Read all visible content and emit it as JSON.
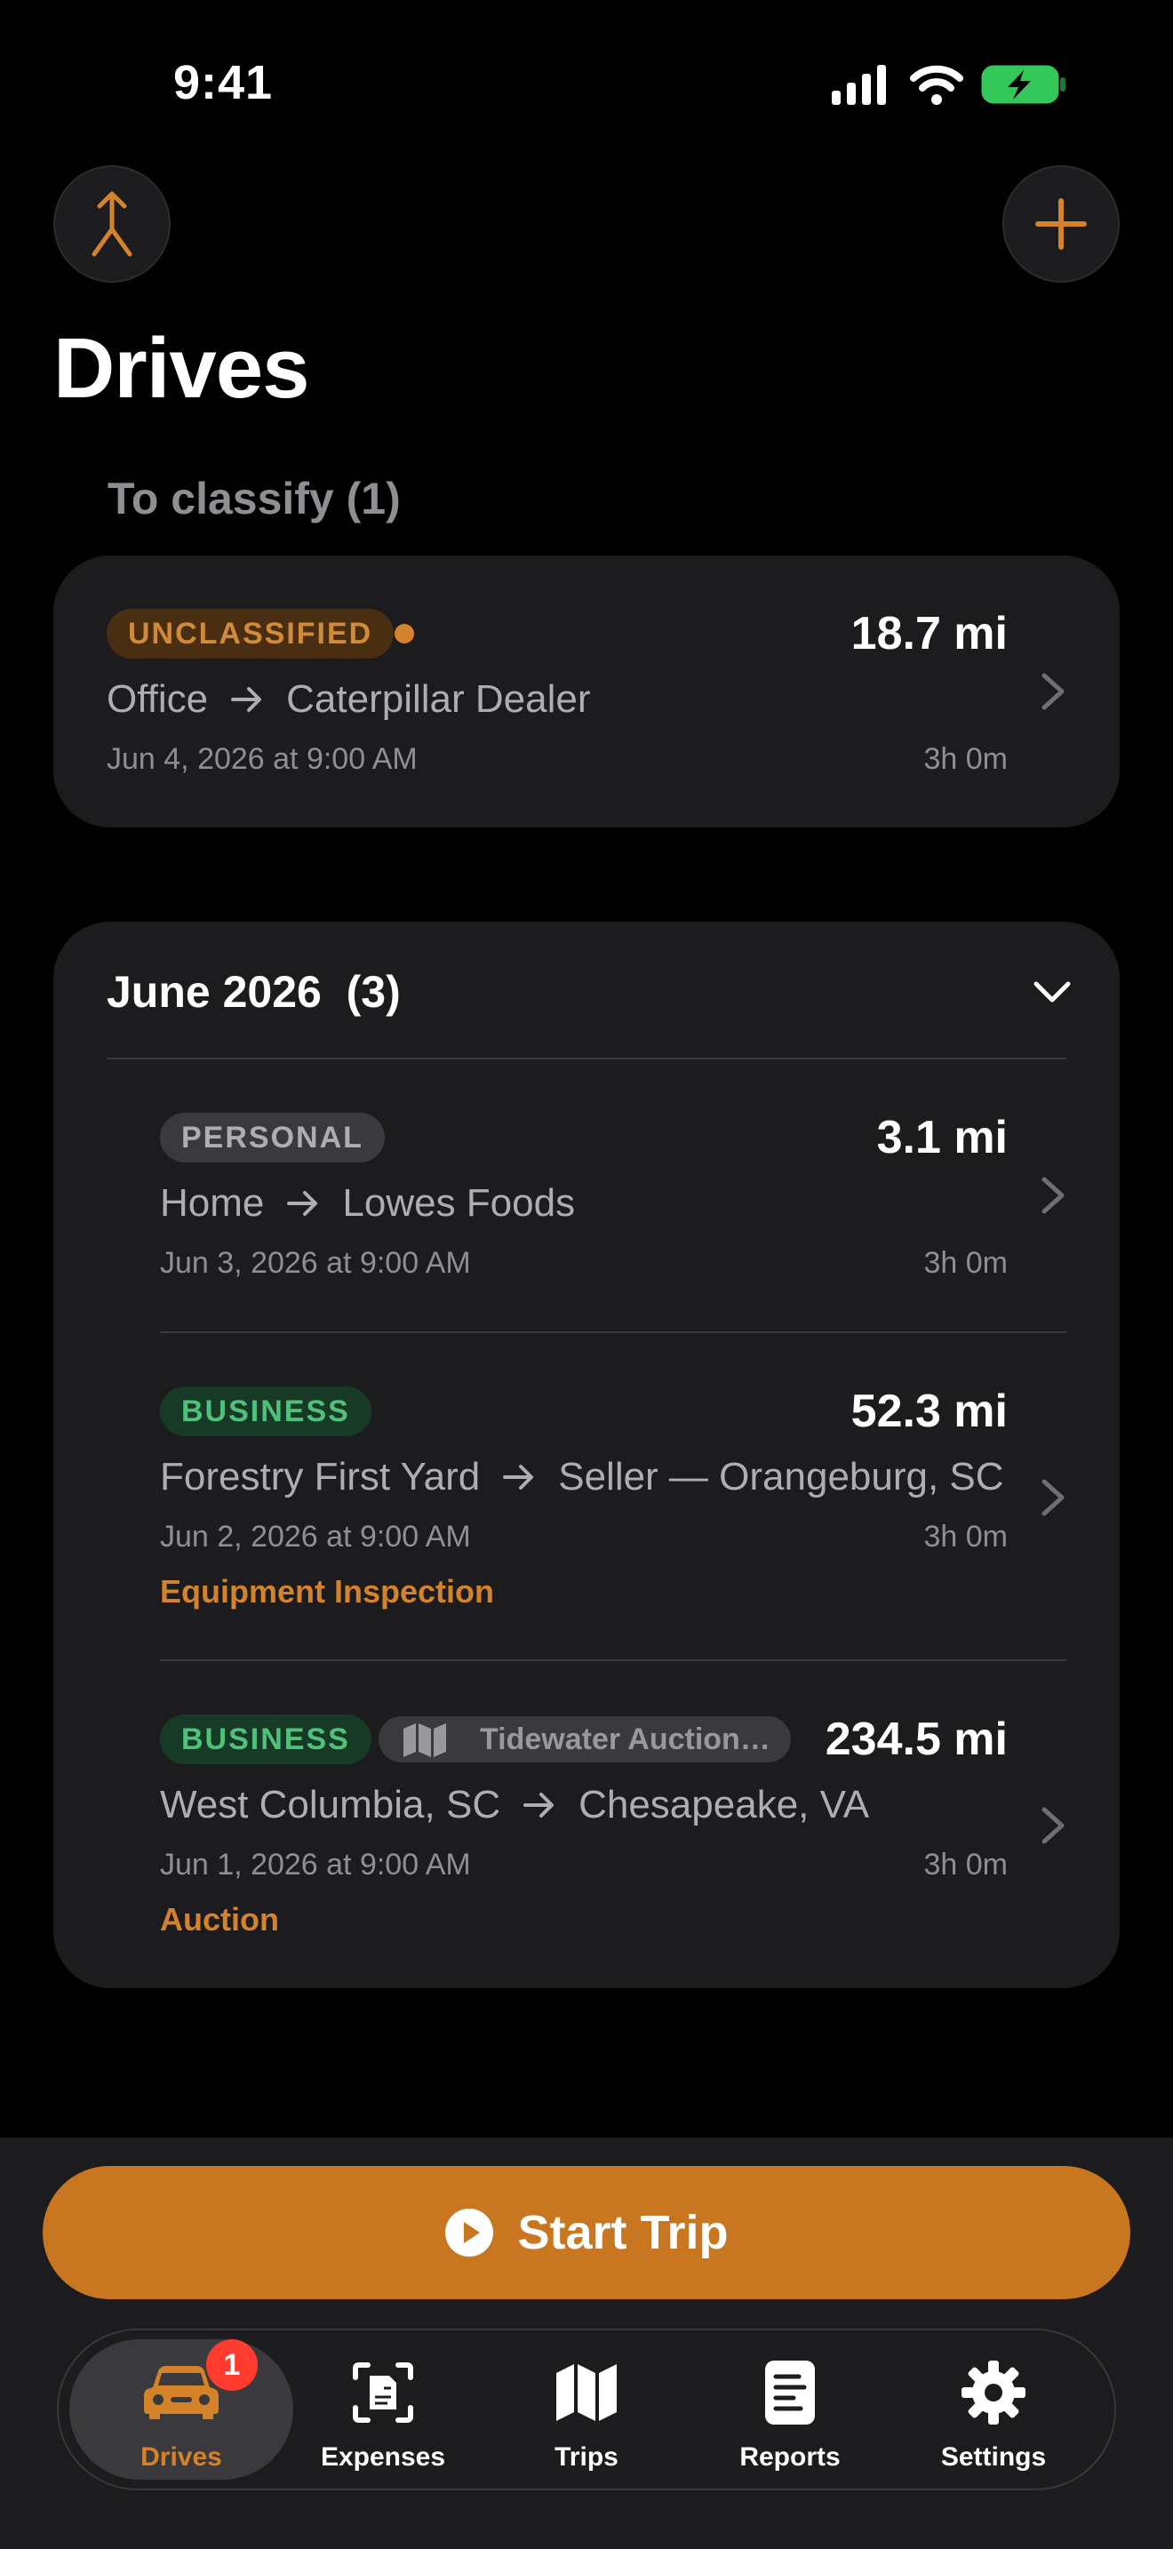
{
  "status_bar": {
    "time": "9:41"
  },
  "header": {
    "title": "Drives"
  },
  "unclassified_section": {
    "label": "To classify (1)",
    "drive": {
      "badge": "UNCLASSIFIED",
      "distance": "18.7 mi",
      "from": "Office",
      "to": "Caterpillar Dealer",
      "date": "Jun 4, 2026 at 9:00 AM",
      "duration": "3h 0m"
    }
  },
  "month_group": {
    "title": "June 2026  (3)",
    "drives": [
      {
        "badge": "PERSONAL",
        "distance": "3.1 mi",
        "from": "Home",
        "to": "Lowes Foods",
        "date": "Jun 3, 2026 at 9:00 AM",
        "duration": "3h 0m",
        "purpose": ""
      },
      {
        "badge": "BUSINESS",
        "distance": "52.3 mi",
        "from": "Forestry First Yard",
        "to": "Seller — Orangeburg, SC",
        "date": "Jun 2, 2026 at 9:00 AM",
        "duration": "3h 0m",
        "purpose": "Equipment Inspection"
      },
      {
        "badge": "BUSINESS",
        "trip_tag": "Tidewater Auction Trip",
        "distance": "234.5 mi",
        "from": "West Columbia, SC",
        "to": "Chesapeake, VA",
        "date": "Jun 1, 2026 at 9:00 AM",
        "duration": "3h 0m",
        "purpose": "Auction"
      }
    ]
  },
  "start_trip": {
    "label": "Start Trip"
  },
  "tab_bar": {
    "items": [
      {
        "label": "Drives",
        "icon": "car-icon",
        "active": true,
        "badge": "1"
      },
      {
        "label": "Expenses",
        "icon": "receipt-scan-icon",
        "active": false
      },
      {
        "label": "Trips",
        "icon": "map-icon",
        "active": false
      },
      {
        "label": "Reports",
        "icon": "report-icon",
        "active": false
      },
      {
        "label": "Settings",
        "icon": "gear-icon",
        "active": false
      }
    ]
  },
  "colors": {
    "accent": "#c87720",
    "badge_business": "#4fc17a",
    "badge_unclassified": "#d18a38",
    "notification": "#ff3b30"
  }
}
